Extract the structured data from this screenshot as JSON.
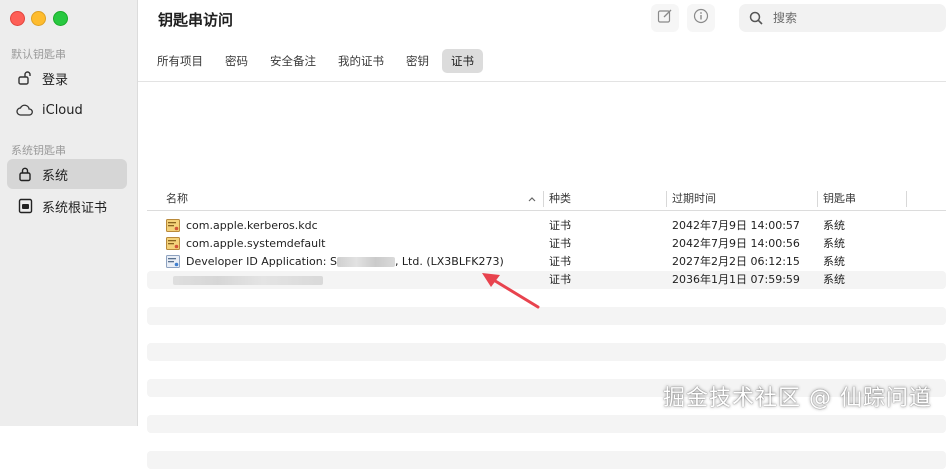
{
  "window": {
    "title": "钥匙串访问"
  },
  "sidebar": {
    "sections": [
      {
        "title": "默认钥匙串",
        "items": [
          {
            "label": "登录",
            "icon": "unlocked-padlock-icon",
            "selected": false
          },
          {
            "label": "iCloud",
            "icon": "cloud-icon",
            "selected": false
          }
        ]
      },
      {
        "title": "系统钥匙串",
        "items": [
          {
            "label": "系统",
            "icon": "padlock-icon",
            "selected": true
          },
          {
            "label": "系统根证书",
            "icon": "cabinet-icon",
            "selected": false
          }
        ]
      }
    ]
  },
  "toolbar": {
    "compose_icon": "compose-icon",
    "info_icon": "info-icon",
    "search": {
      "placeholder": "搜索",
      "value": ""
    }
  },
  "tabs": [
    {
      "label": "所有项目",
      "active": false
    },
    {
      "label": "密码",
      "active": false
    },
    {
      "label": "安全备注",
      "active": false
    },
    {
      "label": "我的证书",
      "active": false
    },
    {
      "label": "密钥",
      "active": false
    },
    {
      "label": "证书",
      "active": true
    }
  ],
  "table": {
    "columns": [
      "名称",
      "种类",
      "过期时间",
      "钥匙串"
    ],
    "rows": [
      {
        "name": "com.apple.kerberos.kdc",
        "kind": "证书",
        "expires": "2042年7月9日 14:00:57",
        "keychain": "系统"
      },
      {
        "name": "com.apple.systemdefault",
        "kind": "证书",
        "expires": "2042年7月9日 14:00:56",
        "keychain": "系统"
      },
      {
        "name_prefix": "Developer ID Application: S",
        "name_suffix": ", Ltd. (LX3BLFK273)",
        "kind": "证书",
        "expires": "2027年2月2日 06:12:15",
        "keychain": "系统"
      },
      {
        "name": "",
        "kind": "证书",
        "expires": "2036年1月1日 07:59:59",
        "keychain": "系统"
      }
    ]
  },
  "colors": {
    "annotation_arrow": "#e8434e",
    "selection": "#d6d6d6"
  },
  "watermark": "掘金技术社区 @ 仙踪问道"
}
